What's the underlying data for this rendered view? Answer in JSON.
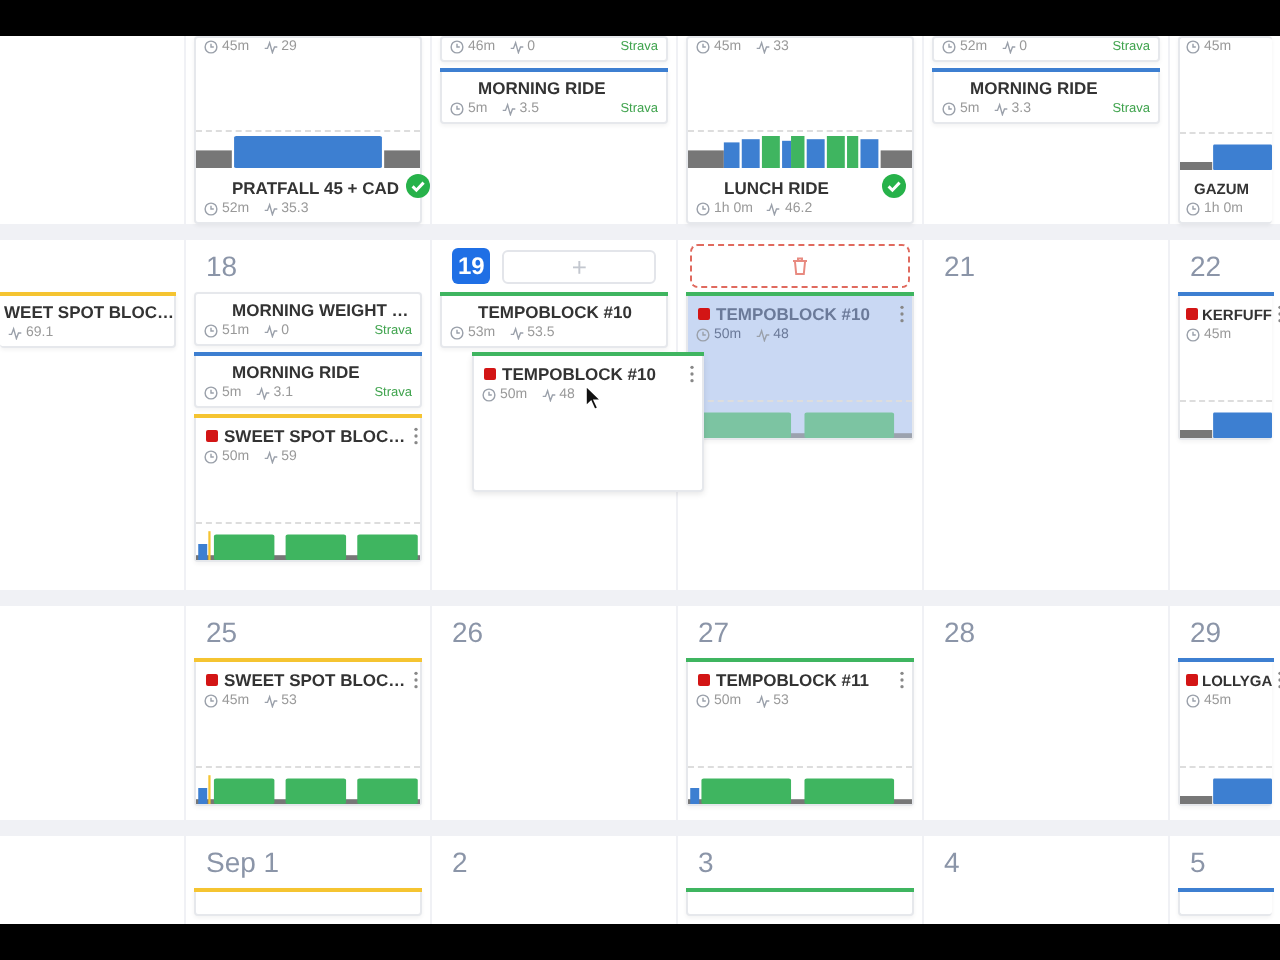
{
  "weeks": [
    {
      "days": [
        {
          "cards": [
            {
              "kind": "completed",
              "duration": "45m",
              "load": "29",
              "profile": {
                "kind": "steady"
              },
              "title": "PRATFALL 45 + CAD",
              "done": true,
              "actual_duration": "52m",
              "actual_load": "35.3"
            }
          ]
        },
        {
          "cards": [
            {
              "kind": "synced",
              "duration": "46m",
              "load": "0",
              "source": "Strava"
            },
            {
              "kind": "synced",
              "color": "#3d7fd1",
              "title": "MORNING RIDE",
              "duration": "5m",
              "load": "3.5",
              "source": "Strava"
            }
          ]
        },
        {
          "cards": [
            {
              "kind": "completed",
              "duration": "45m",
              "load": "33",
              "profile": {
                "kind": "mixed"
              },
              "title": "LUNCH RIDE",
              "done": true,
              "actual_duration": "1h 0m",
              "actual_load": "46.2"
            }
          ]
        },
        {
          "cards": [
            {
              "kind": "synced",
              "duration": "52m",
              "load": "0",
              "source": "Strava"
            },
            {
              "kind": "synced",
              "color": "#3d7fd1",
              "title": "MORNING RIDE",
              "duration": "5m",
              "load": "3.3",
              "source": "Strava"
            }
          ]
        },
        {
          "cards": [
            {
              "kind": "completed",
              "duration": "45m",
              "profile": {
                "kind": "ramp"
              },
              "title": "GAZUM",
              "actual_duration": "1h 0m"
            }
          ]
        }
      ]
    },
    {
      "lead": {
        "cards": [
          {
            "kind": "synced",
            "color": "#f5c431",
            "title": "WEET SPOT BLOC…",
            "load": "69.1"
          }
        ]
      },
      "days": [
        {
          "label": "18",
          "cards": [
            {
              "kind": "synced",
              "title": "MORNING WEIGHT …",
              "duration": "51m",
              "load": "0",
              "source": "Strava"
            },
            {
              "kind": "synced",
              "color": "#3d7fd1",
              "title": "MORNING RIDE",
              "duration": "5m",
              "load": "3.1",
              "source": "Strava"
            },
            {
              "kind": "planned",
              "color": "#f5c431",
              "title": "SWEET SPOT BLOC…",
              "duration": "50m",
              "load": "59",
              "profile": {
                "kind": "sweetspot"
              }
            }
          ]
        },
        {
          "label": "19",
          "today": true,
          "add_button": "+",
          "cards": [
            {
              "kind": "synced",
              "color": "#3fb560",
              "title": "TEMPOBLOCK #10",
              "duration": "53m",
              "load": "53.5"
            }
          ],
          "dragged_card": {
            "kind": "planned",
            "color": "#3fb560",
            "title": "TEMPOBLOCK #10",
            "duration": "50m",
            "load": "48"
          }
        },
        {
          "drop_zone": true,
          "cards": [
            {
              "kind": "planned",
              "ghost": true,
              "color": "#3fb560",
              "title": "TEMPOBLOCK #10",
              "duration": "50m",
              "load": "48",
              "profile": {
                "kind": "tempo"
              }
            }
          ]
        },
        {
          "label": "21"
        },
        {
          "label": "22",
          "cards": [
            {
              "kind": "planned",
              "color": "#3d7fd1",
              "title": "KERFUFF",
              "duration": "45m",
              "profile": {
                "kind": "ramp"
              }
            }
          ]
        }
      ]
    },
    {
      "days": [
        {
          "label": "25",
          "cards": [
            {
              "kind": "planned",
              "color": "#f5c431",
              "title": "SWEET SPOT BLOC…",
              "duration": "45m",
              "load": "53",
              "profile": {
                "kind": "sweetspot"
              }
            }
          ]
        },
        {
          "label": "26"
        },
        {
          "label": "27",
          "cards": [
            {
              "kind": "planned",
              "color": "#3fb560",
              "title": "TEMPOBLOCK #11",
              "duration": "50m",
              "load": "53",
              "profile": {
                "kind": "tempo"
              }
            }
          ]
        },
        {
          "label": "28"
        },
        {
          "label": "29",
          "cards": [
            {
              "kind": "planned",
              "color": "#3d7fd1",
              "title": "LOLLYGA",
              "duration": "45m",
              "profile": {
                "kind": "ramp"
              }
            }
          ]
        }
      ]
    },
    {
      "days": [
        {
          "label": "Sep 1",
          "cards": [
            {
              "kind": "stub",
              "color": "#f5c431"
            }
          ]
        },
        {
          "label": "2"
        },
        {
          "label": "3",
          "cards": [
            {
              "kind": "stub",
              "color": "#3fb560"
            }
          ]
        },
        {
          "label": "4"
        },
        {
          "label": "5",
          "cards": [
            {
              "kind": "stub",
              "color": "#3d7fd1"
            }
          ]
        }
      ]
    }
  ]
}
